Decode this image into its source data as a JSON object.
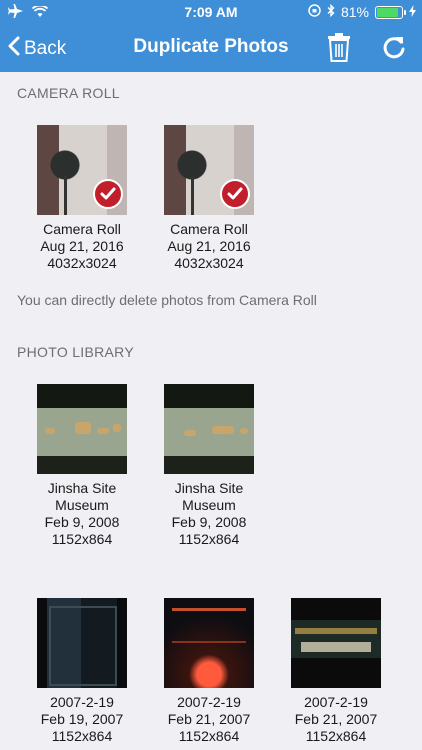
{
  "status_bar": {
    "time": "7:09 AM",
    "battery": "81%"
  },
  "nav": {
    "back_label": "Back",
    "title": "Duplicate Photos",
    "trash_icon": "trash-icon",
    "refresh_icon": "refresh-icon"
  },
  "sections": {
    "camera_roll": {
      "header": "CAMERA ROLL",
      "items": [
        {
          "name": "Camera Roll",
          "date": "Aug 21, 2016",
          "size": "4032x3024",
          "selected": true
        },
        {
          "name": "Camera Roll",
          "date": "Aug 21, 2016",
          "size": "4032x3024",
          "selected": true
        }
      ],
      "note": "You can directly delete photos from Camera Roll"
    },
    "photo_library": {
      "header": "PHOTO LIBRARY",
      "group1": [
        {
          "name_line1": "Jinsha Site",
          "name_line2": "Museum",
          "date": "Feb 9, 2008",
          "size": "1152x864"
        },
        {
          "name_line1": "Jinsha Site",
          "name_line2": "Museum",
          "date": "Feb 9, 2008",
          "size": "1152x864"
        }
      ],
      "group2": [
        {
          "name": "2007-2-19",
          "date": "Feb 19, 2007",
          "size": "1152x864"
        },
        {
          "name": "2007-2-19",
          "date": "Feb 21, 2007",
          "size": "1152x864"
        },
        {
          "name": "2007-2-19",
          "date": "Feb 21, 2007",
          "size": "1152x864"
        }
      ]
    }
  },
  "colors": {
    "nav_bar": "#3f8fd8",
    "background": "#efeff4",
    "check_badge": "#c21f2c"
  }
}
